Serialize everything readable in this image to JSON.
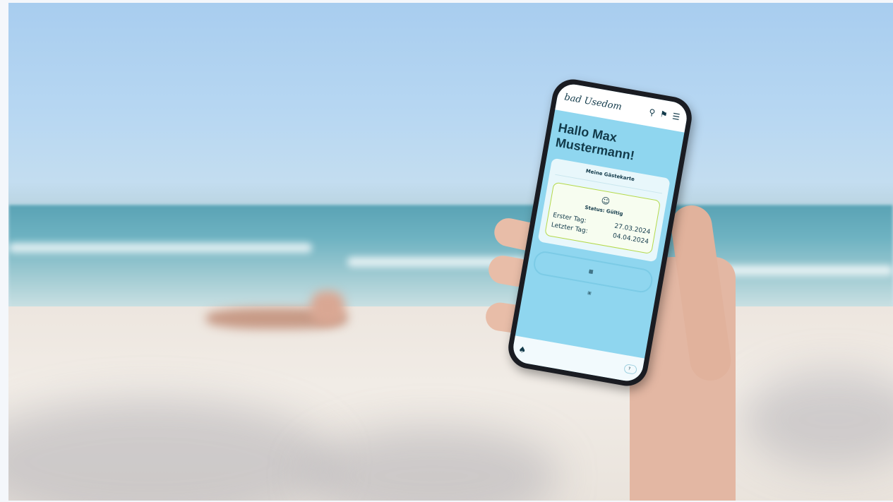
{
  "app": {
    "logo_text": "bad Usedom",
    "icons": [
      "search-icon",
      "notification-icon",
      "menu-icon"
    ],
    "breadcrumb": "",
    "greeting_line1": "Hallo Max",
    "greeting_line2": "Mustermann!"
  },
  "card": {
    "title": "Meine Gästekarte",
    "status_icon": "smiley-icon",
    "status_text": "Status: Gültig",
    "rows": [
      {
        "label": "Erster Tag:",
        "value": "27.03.2024"
      },
      {
        "label": "Letzter Tag:",
        "value": "04.04.2024"
      }
    ]
  },
  "actions": {
    "primary_label": "",
    "primary_icon": "qr-code-icon",
    "secondary_label": "",
    "secondary_icon": "card-icon"
  },
  "user": {
    "name": "",
    "user_icon": "user-icon",
    "help_label": "",
    "help_icon": "help-icon"
  },
  "colors": {
    "accent": "#8fd6ef",
    "text_dark": "#123a4a",
    "status_border": "#b4d94a"
  }
}
